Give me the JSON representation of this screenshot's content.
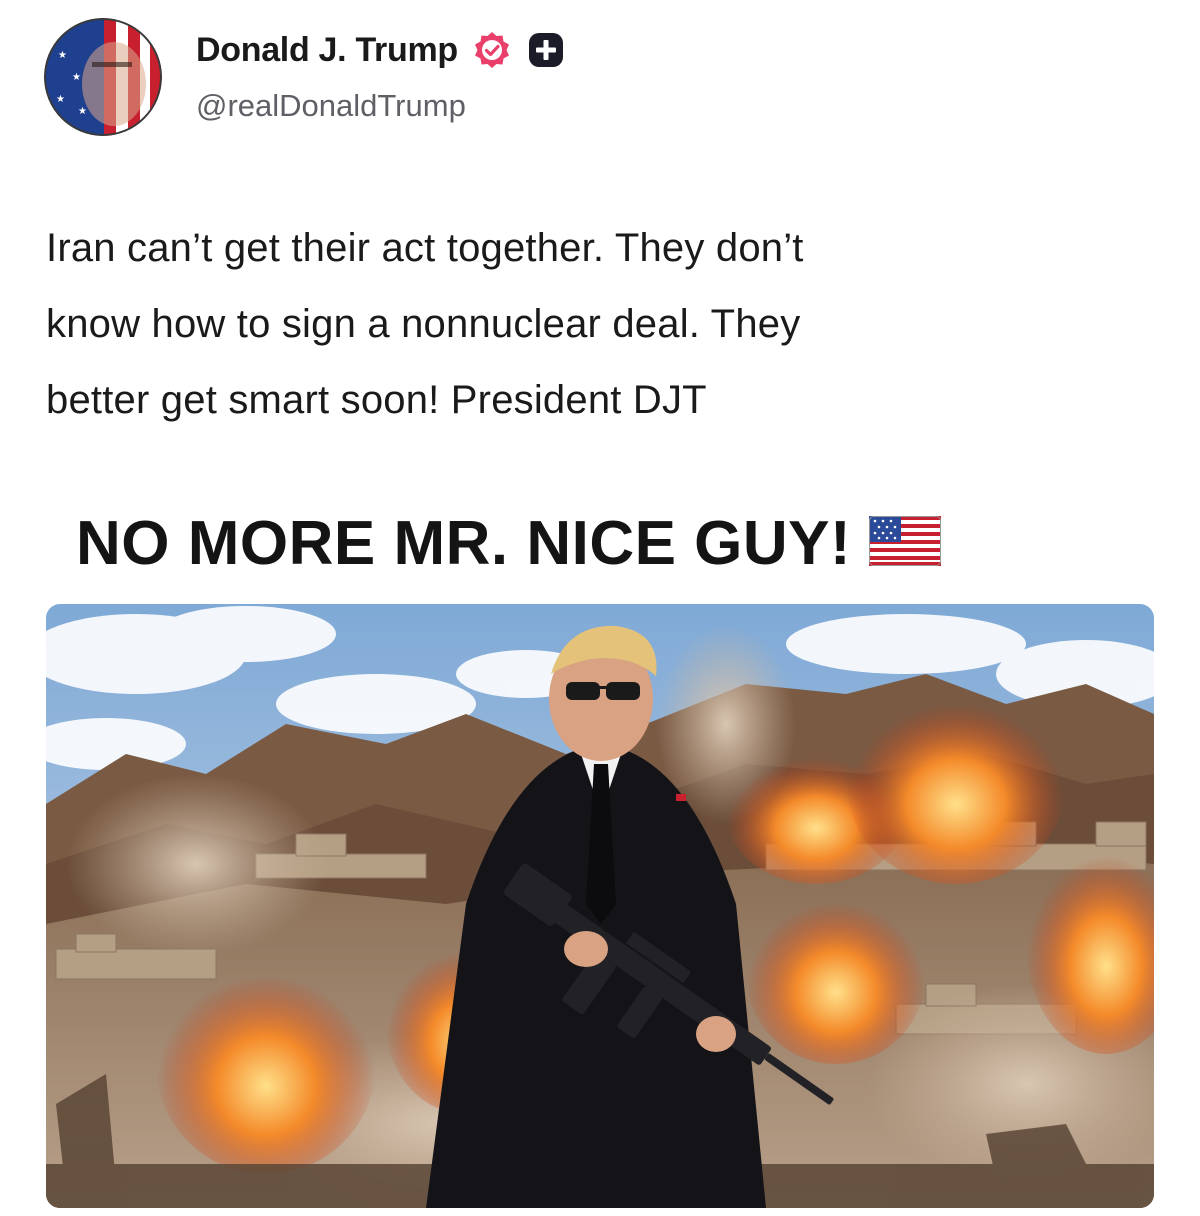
{
  "author": {
    "display_name": "Donald J. Trump",
    "handle": "@realDonaldTrump",
    "verified_icon": "verified-badge-icon",
    "plus_icon": "plus-badge-icon",
    "verified_color": "#e8406a"
  },
  "post": {
    "text_lines": [
      "Iran can’t get their act together. They don’t",
      "know how to sign a nonnuclear deal. They",
      "better get smart soon! President DJT"
    ]
  },
  "media": {
    "headline": "NO MORE MR. NICE GUY!",
    "flag_icon": "us-flag-icon"
  }
}
